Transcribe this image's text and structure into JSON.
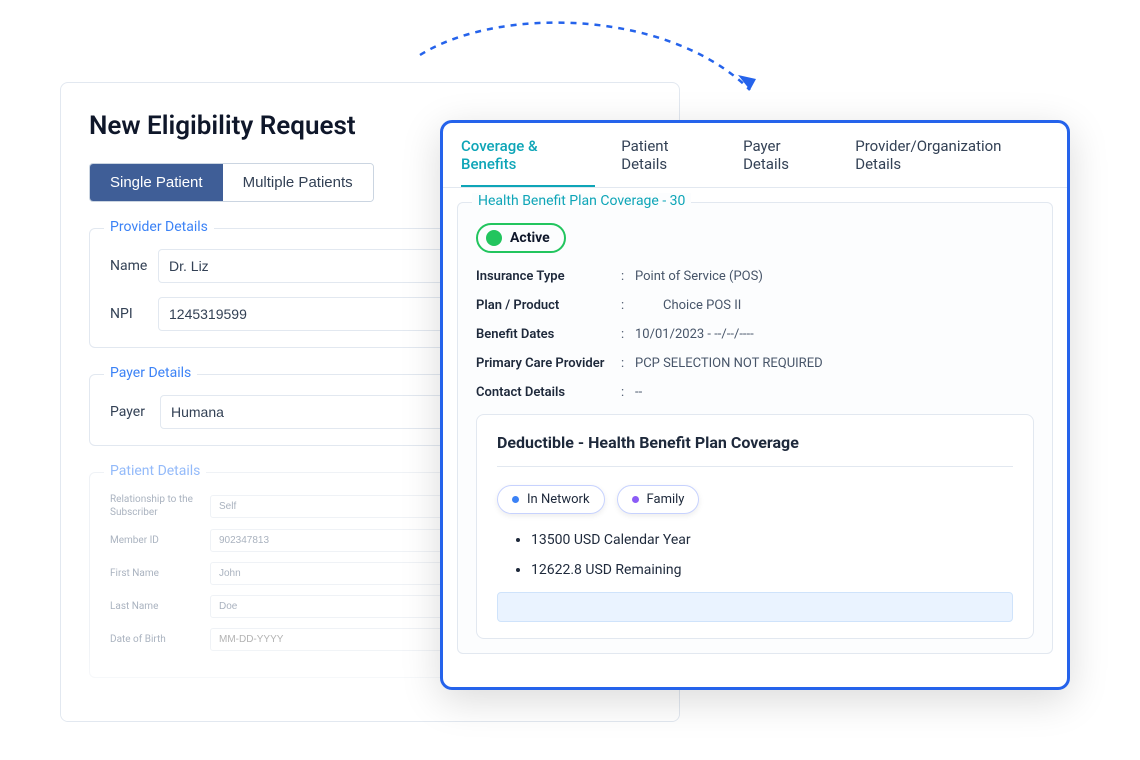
{
  "left": {
    "title": "New Eligibility Request",
    "tabs": {
      "single": "Single Patient",
      "multiple": "Multiple Patients"
    },
    "provider": {
      "legend": "Provider Details",
      "name_label": "Name",
      "name_value": "Dr. Liz",
      "npi_label": "NPI",
      "npi_value": "1245319599"
    },
    "payer": {
      "legend": "Payer Details",
      "payer_label": "Payer",
      "payer_value": "Humana"
    },
    "patient": {
      "legend": "Patient Details",
      "rows": [
        {
          "label": "Relationship to the Subscriber",
          "value": "Self"
        },
        {
          "label": "Member ID",
          "value": "902347813"
        },
        {
          "label": "First Name",
          "value": "John"
        },
        {
          "label": "Last Name",
          "value": "Doe"
        },
        {
          "label": "Date of Birth",
          "value": "MM-DD-YYYY"
        }
      ]
    }
  },
  "right": {
    "tabs": {
      "coverage": "Coverage & Benefits",
      "patient": "Patient Details",
      "payer": "Payer Details",
      "provider": "Provider/Organization Details"
    },
    "coverage": {
      "legend": "Health Benefit Plan Coverage - 30",
      "status": "Active",
      "rows": [
        {
          "key": "Insurance Type",
          "val": "Point of Service (POS)"
        },
        {
          "key": "Plan / Product",
          "val": "Choice POS II"
        },
        {
          "key": "Benefit Dates",
          "val": "10/01/2023 - --/--/----"
        },
        {
          "key": "Primary Care Provider",
          "val": "PCP SELECTION NOT REQUIRED"
        },
        {
          "key": "Contact Details",
          "val": "--"
        }
      ],
      "deductible": {
        "title": "Deductible - Health Benefit Plan Coverage",
        "chips": {
          "network": "In Network",
          "family": "Family"
        },
        "bullets": [
          "13500 USD Calendar Year",
          "12622.8 USD Remaining"
        ]
      }
    }
  }
}
